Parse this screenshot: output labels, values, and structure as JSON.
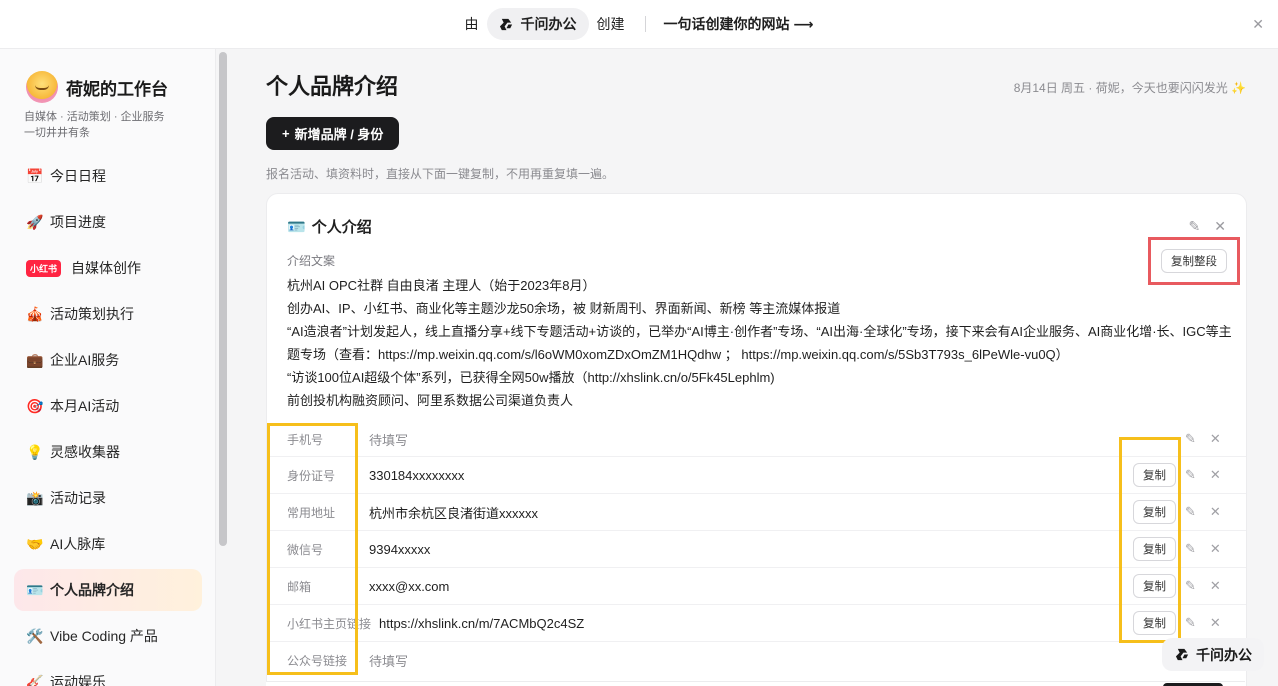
{
  "topbar": {
    "by": "由",
    "brand": "千问办公",
    "create": "创建",
    "slogan": "一句话创建你的网站 ⟶",
    "close_icon": "close-icon"
  },
  "sidebar": {
    "workspace_title": "荷妮的工作台",
    "workspace_sub1": "自媒体 · 活动策划 · 企业服务",
    "workspace_sub2": "一切井井有条",
    "items": [
      {
        "icon": "📅",
        "label": "今日日程"
      },
      {
        "icon": "🚀",
        "label": "项目进度"
      },
      {
        "badge": "小红书",
        "label": "自媒体创作"
      },
      {
        "icon": "🎪",
        "label": "活动策划执行"
      },
      {
        "icon": "💼",
        "label": "企业AI服务"
      },
      {
        "icon": "🎯",
        "label": "本月AI活动"
      },
      {
        "icon": "💡",
        "label": "灵感收集器"
      },
      {
        "icon": "📸",
        "label": "活动记录"
      },
      {
        "icon": "🤝",
        "label": "AI人脉库"
      },
      {
        "icon": "🪪",
        "label": "个人品牌介绍"
      },
      {
        "icon": "🛠️",
        "label": "Vibe Coding 产品"
      },
      {
        "icon": "🎸",
        "label": "运动娱乐"
      }
    ],
    "active_index": 9
  },
  "main": {
    "title": "个人品牌介绍",
    "date": "8月14日 周五 · 荷妮，今天也要闪闪发光 ✨",
    "add_button": "新增品牌 / 身份",
    "add_icon": "+",
    "hint": "报名活动、填资料时，直接从下面一键复制，不用再重复填一遍。",
    "card": {
      "icon": "🪪",
      "title": "个人介绍",
      "copy_all": "复制整段",
      "intro_label": "介绍文案",
      "intro_lines": [
        "杭州AI OPC社群 自由良渚 主理人（始于2023年8月）",
        "创办AI、IP、小红书、商业化等主题沙龙50余场，被 财新周刊、界面新闻、新榜 等主流媒体报道",
        "“AI造浪者”计划发起人，线上直播分享+线下专题活动+访谈的，已举办“AI博主·创作者”专场、“AI出海·全球化”专场，接下来会有AI企业服务、AI商业化增·长、IGC等主题专场（查看：https://mp.weixin.qq.com/s/l6oWM0xomZDxOmZM1HQdhw ； https://mp.weixin.qq.com/s/5Sb3T793s_6lPeWle-vu0Q）",
        "“访谈100位AI超级个体”系列，已获得全网50w播放（http://xhslink.cn/o/5Fk45Lephlm)",
        "前创投机构融资顾问、阿里系数据公司渠道负责人"
      ],
      "fields": [
        {
          "label": "手机号",
          "value": "待填写",
          "empty": true,
          "copy": ""
        },
        {
          "label": "身份证号",
          "value": "330184xxxxxxxx",
          "empty": false,
          "copy": "复制"
        },
        {
          "label": "常用地址",
          "value": "杭州市余杭区良渚街道xxxxxx",
          "empty": false,
          "copy": "复制"
        },
        {
          "label": "微信号",
          "value": "9394xxxxx",
          "empty": false,
          "copy": "复制"
        },
        {
          "label": "邮箱",
          "value": "xxxx@xx.com",
          "empty": false,
          "copy": "复制"
        },
        {
          "label": "小红书主页链接",
          "value": "https://xhslink.cn/m/7ACMbQ2c4SZ",
          "empty": false,
          "copy": "复制"
        },
        {
          "label": "公众号链接",
          "value": "待填写",
          "empty": true,
          "copy": ""
        }
      ]
    }
  },
  "float_badge": "千问办公"
}
